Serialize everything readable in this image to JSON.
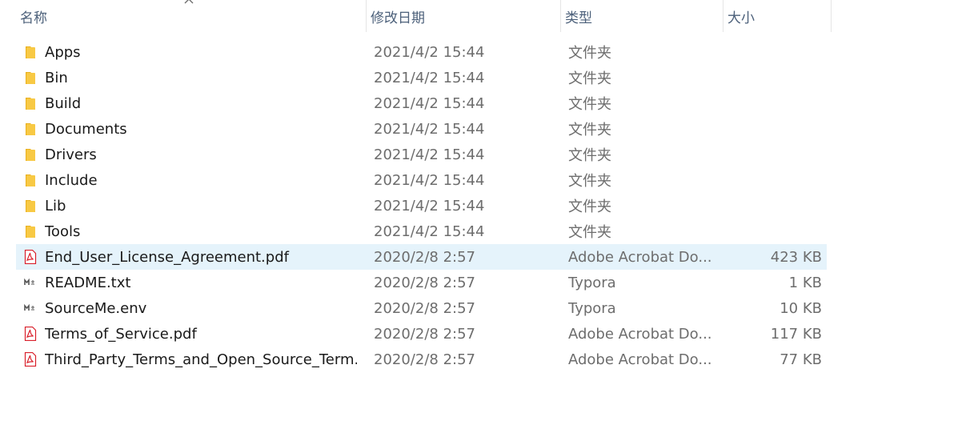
{
  "columns": {
    "name": "名称",
    "date": "修改日期",
    "type": "类型",
    "size": "大小"
  },
  "files": [
    {
      "name": "Apps",
      "date": "2021/4/2 15:44",
      "type": "文件夹",
      "size": "",
      "icon": "folder-icon"
    },
    {
      "name": "Bin",
      "date": "2021/4/2 15:44",
      "type": "文件夹",
      "size": "",
      "icon": "folder-icon"
    },
    {
      "name": "Build",
      "date": "2021/4/2 15:44",
      "type": "文件夹",
      "size": "",
      "icon": "folder-icon"
    },
    {
      "name": "Documents",
      "date": "2021/4/2 15:44",
      "type": "文件夹",
      "size": "",
      "icon": "folder-icon"
    },
    {
      "name": "Drivers",
      "date": "2021/4/2 15:44",
      "type": "文件夹",
      "size": "",
      "icon": "folder-icon"
    },
    {
      "name": "Include",
      "date": "2021/4/2 15:44",
      "type": "文件夹",
      "size": "",
      "icon": "folder-icon"
    },
    {
      "name": "Lib",
      "date": "2021/4/2 15:44",
      "type": "文件夹",
      "size": "",
      "icon": "folder-icon"
    },
    {
      "name": "Tools",
      "date": "2021/4/2 15:44",
      "type": "文件夹",
      "size": "",
      "icon": "folder-icon"
    },
    {
      "name": "End_User_License_Agreement.pdf",
      "date": "2020/2/8 2:57",
      "type": "Adobe Acrobat Do...",
      "size": "423 KB",
      "icon": "pdf-icon",
      "selected": true
    },
    {
      "name": "README.txt",
      "date": "2020/2/8 2:57",
      "type": "Typora",
      "size": "1 KB",
      "icon": "markdown-icon"
    },
    {
      "name": "SourceMe.env",
      "date": "2020/2/8 2:57",
      "type": "Typora",
      "size": "10 KB",
      "icon": "markdown-icon"
    },
    {
      "name": "Terms_of_Service.pdf",
      "date": "2020/2/8 2:57",
      "type": "Adobe Acrobat Do...",
      "size": "117 KB",
      "icon": "pdf-icon"
    },
    {
      "name": "Third_Party_Terms_and_Open_Source_Term...",
      "date": "2020/2/8 2:57",
      "type": "Adobe Acrobat Do...",
      "size": "77 KB",
      "icon": "pdf-icon"
    }
  ],
  "colors": {
    "selected_row": "#e5f3fb",
    "folder": "#f8c944",
    "pdf": "#d9202b",
    "header_text": "#4c607a"
  }
}
